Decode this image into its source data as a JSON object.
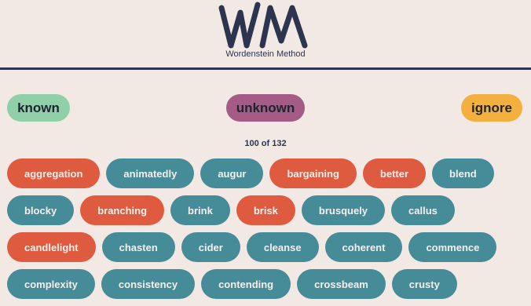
{
  "brand": {
    "logo_letters": "WM",
    "name": "Wordenstein Method"
  },
  "actions": {
    "known": "known",
    "unknown": "unknown",
    "ignore": "ignore"
  },
  "progress": {
    "text": "100 of 132",
    "current": 100,
    "total": 132
  },
  "colors": {
    "teal": "#468b98",
    "red": "#df5b40",
    "known": "#8fd0a8",
    "unknown": "#a45b85",
    "ignore": "#f3b03e",
    "navy": "#2d3450"
  },
  "words": [
    [
      {
        "text": "aggregation",
        "state": "red"
      },
      {
        "text": "animatedly",
        "state": "teal"
      },
      {
        "text": "augur",
        "state": "teal"
      },
      {
        "text": "bargaining",
        "state": "red"
      },
      {
        "text": "better",
        "state": "red"
      },
      {
        "text": "blend",
        "state": "teal"
      }
    ],
    [
      {
        "text": "blocky",
        "state": "teal"
      },
      {
        "text": "branching",
        "state": "red"
      },
      {
        "text": "brink",
        "state": "teal"
      },
      {
        "text": "brisk",
        "state": "red"
      },
      {
        "text": "brusquely",
        "state": "teal"
      },
      {
        "text": "callus",
        "state": "teal"
      }
    ],
    [
      {
        "text": "candlelight",
        "state": "red"
      },
      {
        "text": "chasten",
        "state": "teal"
      },
      {
        "text": "cider",
        "state": "teal"
      },
      {
        "text": "cleanse",
        "state": "teal"
      },
      {
        "text": "coherent",
        "state": "teal"
      },
      {
        "text": "commence",
        "state": "teal"
      }
    ],
    [
      {
        "text": "complexity",
        "state": "teal"
      },
      {
        "text": "consistency",
        "state": "teal"
      },
      {
        "text": "contending",
        "state": "teal"
      },
      {
        "text": "crossbeam",
        "state": "teal"
      },
      {
        "text": "crusty",
        "state": "teal"
      }
    ]
  ]
}
